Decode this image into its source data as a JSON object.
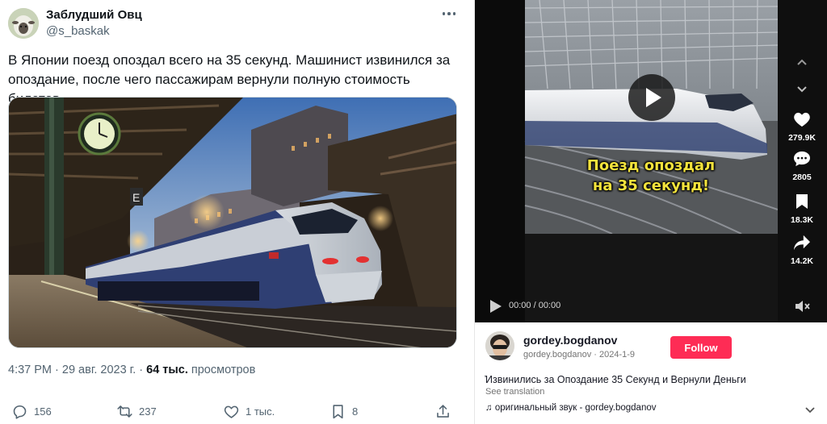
{
  "tweet": {
    "author_name": "Заблудший Овц",
    "author_handle": "@s_baskak",
    "text": "В Японии поезд опоздал всего на 35 секунд. Машинист извинился за опоздание, после чего пассажирам вернули полную стоимость билетов",
    "meta": {
      "time": "4:37 PM",
      "sep1": " · ",
      "date": "29 авг. 2023 г.",
      "sep2": " · ",
      "views": "64 тыс.",
      "views_label": " просмотров"
    },
    "actions": {
      "reply": {
        "icon": "reply-icon",
        "count": "156"
      },
      "retweet": {
        "icon": "retweet-icon",
        "count": "237"
      },
      "like": {
        "icon": "heart-icon",
        "count": "1 тыс."
      },
      "bookmark": {
        "icon": "bookmark-icon",
        "count": "8"
      },
      "share": {
        "icon": "share-icon"
      }
    },
    "photo_sign": "E"
  },
  "video": {
    "caption_line1": "Поезд опоздал",
    "caption_line2": "на 35 секунд!",
    "time": "00:00 / 00:00",
    "side": {
      "likes": "279.9K",
      "comments": "2805",
      "saves": "18.3K",
      "shares": "14.2K"
    }
  },
  "creator": {
    "username": "gordey.bogdanov",
    "subline": "gordey.bogdanov · 2024-1-9",
    "follow_label": "Follow",
    "description": "҆Извинились за Опоздание 35 Секунд и Вернули Деньги",
    "see_translation": "See translation",
    "sound": "♫ оригинальный звук - gordey.bogdanov"
  },
  "colors": {
    "follow": "#fe2c55",
    "caption": "#f3e33c",
    "muted": "#536471"
  }
}
